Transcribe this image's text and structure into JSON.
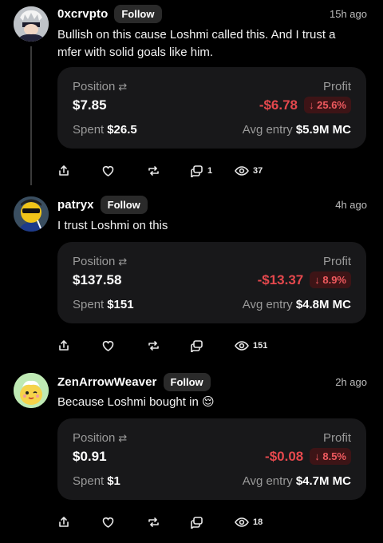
{
  "posts": [
    {
      "username": "0xcrvpto",
      "follow_label": "Follow",
      "time": "15h ago",
      "text": "Bullish on this cause Loshmi called this. And I trust a mfer with solid goals like him.",
      "position_label": "Position",
      "position_value": "$7.85",
      "spent_label": "Spent",
      "spent_value": "$26.5",
      "profit_label": "Profit",
      "profit_value": "-$6.78",
      "profit_pct": "↓ 25.6%",
      "avg_label": "Avg entry",
      "avg_value": "$5.9M MC",
      "comment_count": "1",
      "view_count": "37"
    },
    {
      "username": "patryx",
      "follow_label": "Follow",
      "time": "4h ago",
      "text": "I trust Loshmi on this",
      "position_label": "Position",
      "position_value": "$137.58",
      "spent_label": "Spent",
      "spent_value": "$151",
      "profit_label": "Profit",
      "profit_value": "-$13.37",
      "profit_pct": "↓ 8.9%",
      "avg_label": "Avg entry",
      "avg_value": "$4.8M MC",
      "comment_count": "",
      "view_count": "151"
    },
    {
      "username": "ZenArrowWeaver",
      "follow_label": "Follow",
      "time": "2h ago",
      "text": "Because Loshmi bought in 😌",
      "position_label": "Position",
      "position_value": "$0.91",
      "spent_label": "Spent",
      "spent_value": "$1",
      "profit_label": "Profit",
      "profit_value": "-$0.08",
      "profit_pct": "↓ 8.5%",
      "avg_label": "Avg entry",
      "avg_value": "$4.7M MC",
      "comment_count": "",
      "view_count": "18"
    }
  ],
  "colors": {
    "background": "#000000",
    "card": "#18181a",
    "loss": "#e5484d",
    "loss_badge_bg": "#3d1416",
    "muted": "#9a9a9a"
  },
  "icons": [
    "share-icon",
    "heart-icon",
    "repost-icon",
    "comment-icon",
    "eye-icon",
    "swap-arrows-icon"
  ]
}
